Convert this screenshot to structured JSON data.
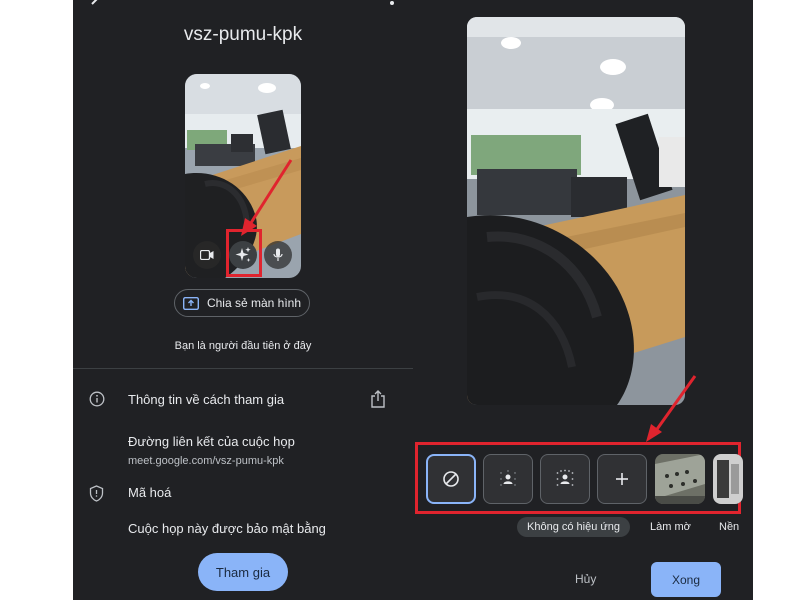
{
  "left": {
    "meeting_code": "vsz-pumu-kpk",
    "share_screen_label": "Chia sẻ màn hình",
    "first_here_text": "Bạn là người đầu tiên ở đây",
    "join_info_title": "Thông tin về cách tham gia",
    "meeting_link_label": "Đường liên kết của cuộc họp",
    "meeting_link_url": "meet.google.com/vsz-pumu-kpk",
    "encryption_title": "Mã hoá",
    "encryption_text": "Cuộc họp này được bảo mật bằng",
    "join_button": "Tham gia"
  },
  "right": {
    "effects": {
      "labels": [
        "Không có hiệu ứng",
        "Làm mờ",
        "Nền"
      ]
    },
    "cancel_button": "Hủy",
    "done_button": "Xong"
  },
  "colors": {
    "background": "#202124",
    "accent": "#8ab4f8",
    "highlight_box": "#e0242e"
  }
}
